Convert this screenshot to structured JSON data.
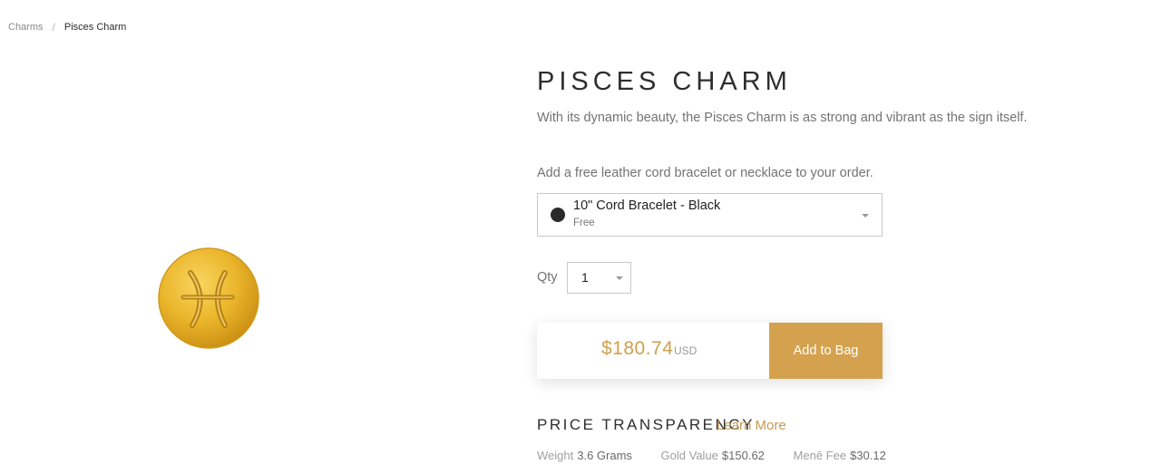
{
  "breadcrumb": {
    "parent": "Charms",
    "separator": "/",
    "current": "Pisces Charm"
  },
  "product": {
    "image_icon": "pisces-gold-charm-icon",
    "title": "PISCES CHARM",
    "description": "With its dynamic beauty, the Pisces Charm is as strong and vibrant as the sign itself."
  },
  "addon": {
    "label": "Add a free leather cord bracelet or necklace to your order.",
    "selected_name": "10\" Cord Bracelet - Black",
    "selected_price": "Free",
    "swatch_color": "#2a2a2a"
  },
  "qty": {
    "label": "Qty",
    "value": "1"
  },
  "purchase": {
    "price": "$180.74",
    "currency": "USD",
    "add_label": "Add to Bag",
    "accent_color": "#d4a24e"
  },
  "transparency": {
    "title": "PRICE TRANSPARENCY",
    "learn_more": "Learn More",
    "weight_label": "Weight",
    "weight_value": "3.6 Grams",
    "gold_label": "Gold Value",
    "gold_value": "$150.62",
    "fee_label": "Menē Fee",
    "fee_value": "$30.12"
  }
}
